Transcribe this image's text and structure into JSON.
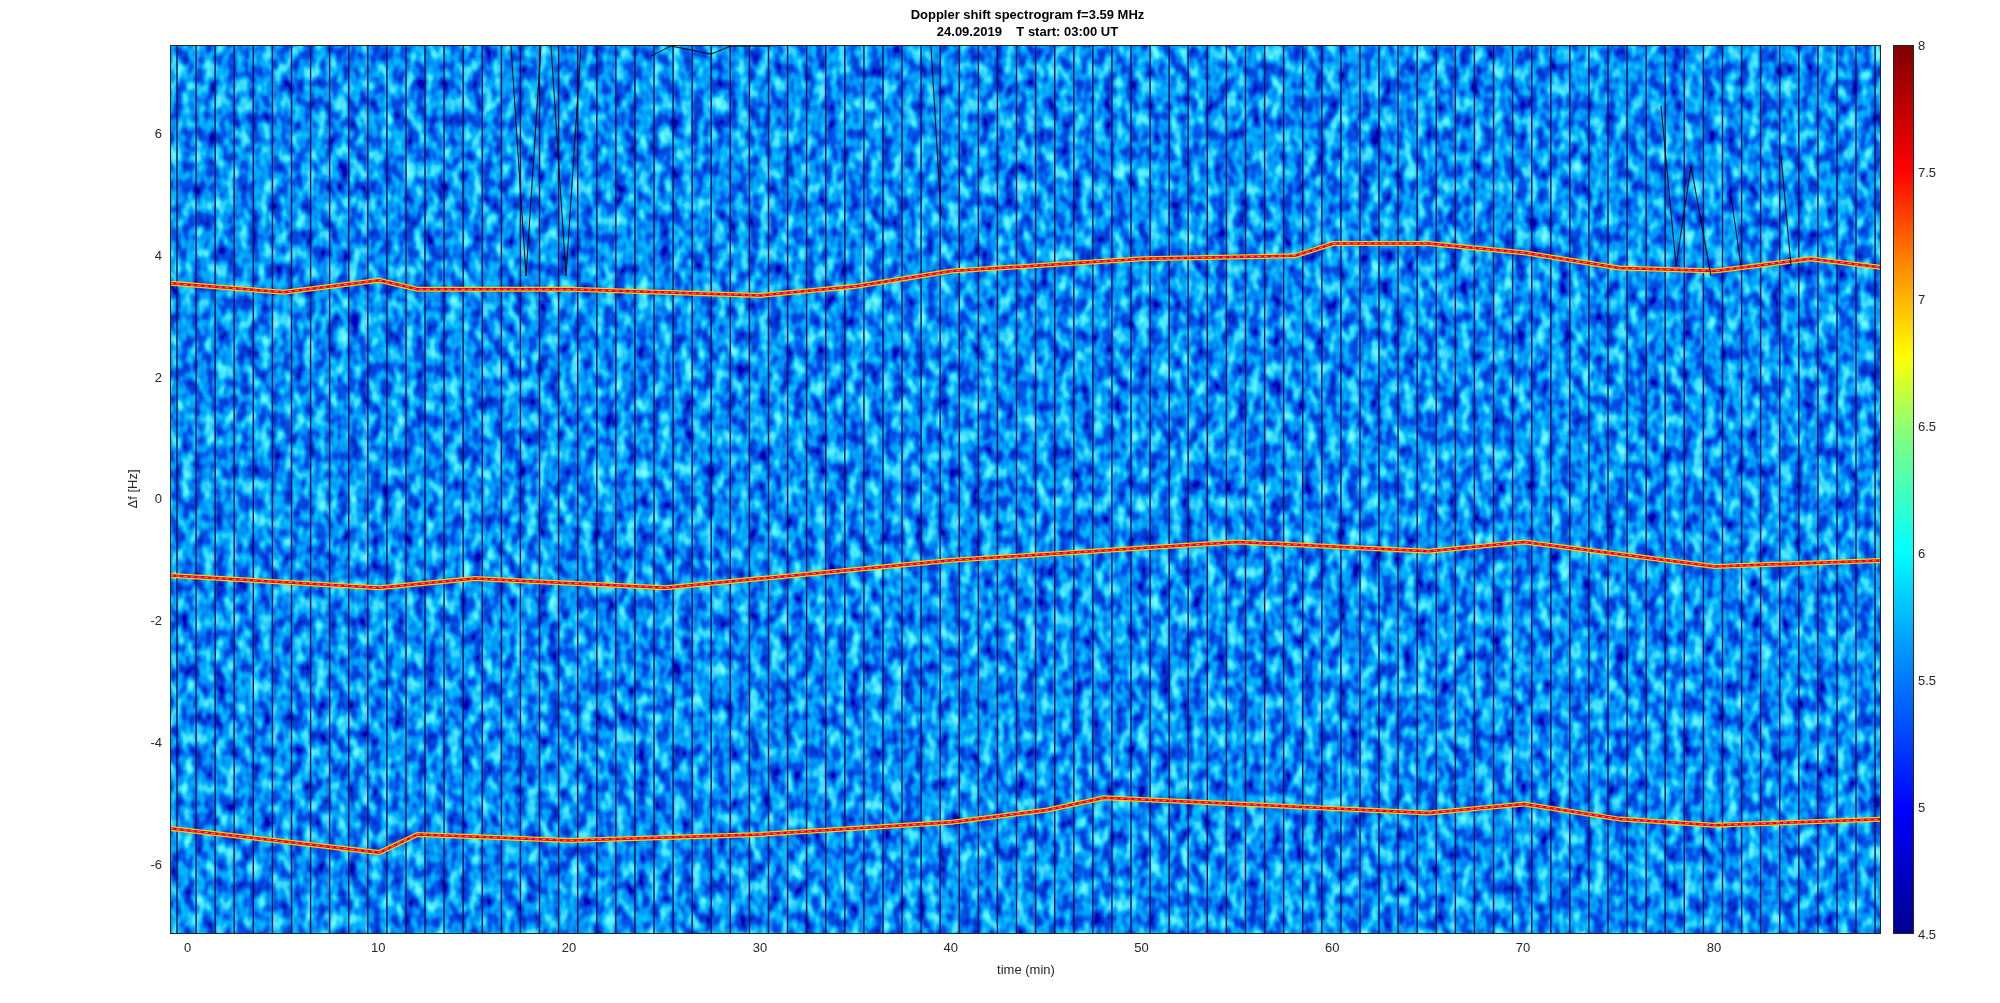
{
  "figure": {
    "title_lines": [
      "Doppler shift spectrogram f=3.59 MHz",
      "24.09.2019    T start: 03:00 UT"
    ],
    "ylabel": "Δf [Hz]",
    "yticks": [
      "6",
      "4",
      "2",
      "0",
      "-2",
      "-4",
      "-6"
    ],
    "xlabel": "time (min)",
    "xticks": [
      "0",
      "10",
      "20",
      "30",
      "40",
      "50",
      "60",
      "70",
      "80"
    ],
    "colorbar_ticks": [
      "8",
      "7.5",
      "7",
      "6.5",
      "6",
      "5.5",
      "5",
      "4.5"
    ]
  }
}
